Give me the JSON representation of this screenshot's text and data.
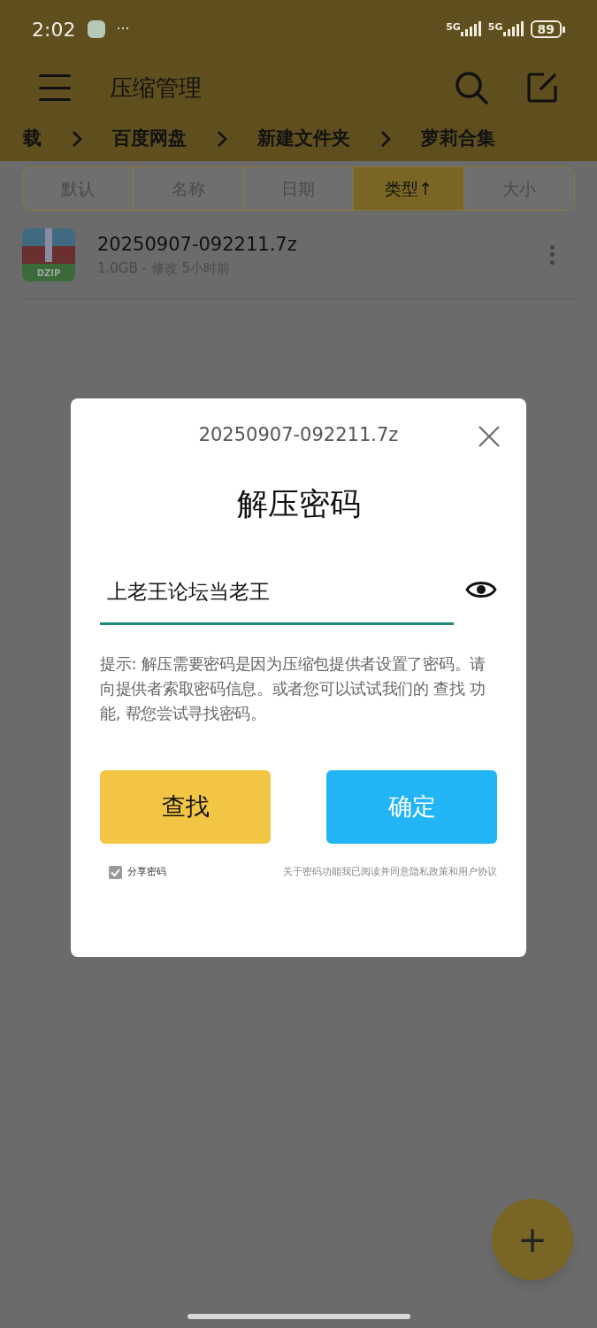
{
  "status_bar": {
    "time": "2:02",
    "more": "···",
    "networks": [
      "5G",
      "5G"
    ],
    "battery": "89"
  },
  "app_bar": {
    "title": "压缩管理"
  },
  "breadcrumbs": [
    "载",
    "百度网盘",
    "新建文件夹",
    "萝莉合集"
  ],
  "sort_tabs": [
    {
      "label": "默认",
      "selected": false
    },
    {
      "label": "名称",
      "selected": false
    },
    {
      "label": "日期",
      "selected": false
    },
    {
      "label": "类型↑",
      "selected": true
    },
    {
      "label": "大小",
      "selected": false
    }
  ],
  "files": [
    {
      "name": "20250907-092211.7z",
      "meta": "1.0GB - 修改 5小时前",
      "icon_label": "DZIP"
    }
  ],
  "dialog": {
    "file_name": "20250907-092211.7z",
    "title": "解压密码",
    "password": "上老王论坛当老王",
    "hint": "提示: 解压需要密码是因为压缩包提供者设置了密码。请向提供者索取密码信息。或者您可以试试我们的 查找 功能, 帮您尝试寻找密码。",
    "buttons": [
      {
        "label": "查找",
        "kind": "secondary"
      },
      {
        "label": "确定",
        "kind": "primary"
      }
    ],
    "share": {
      "label": "分享密码",
      "checked": true
    },
    "agreement": "关于密码功能我已阅读并同意隐私政策和用户协议"
  },
  "fab": {
    "label": "+"
  }
}
